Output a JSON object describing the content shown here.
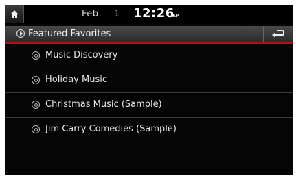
{
  "status": {
    "date": "Feb.",
    "day": "1",
    "time": "12:26",
    "ampm": "AM"
  },
  "header": {
    "title": "Featured Favorites",
    "left_icon": "play-circle-icon",
    "back_icon": "back-arrow-icon",
    "accent_color": "#b01010"
  },
  "home": {
    "icon": "home-icon"
  },
  "list": {
    "items": [
      {
        "label": "Music Discovery",
        "icon": "station-icon"
      },
      {
        "label": "Holiday Music",
        "icon": "station-icon"
      },
      {
        "label": "Christmas Music (Sample)",
        "icon": "station-icon"
      },
      {
        "label": "Jim Carry Comedies (Sample)",
        "icon": "station-icon"
      }
    ]
  }
}
